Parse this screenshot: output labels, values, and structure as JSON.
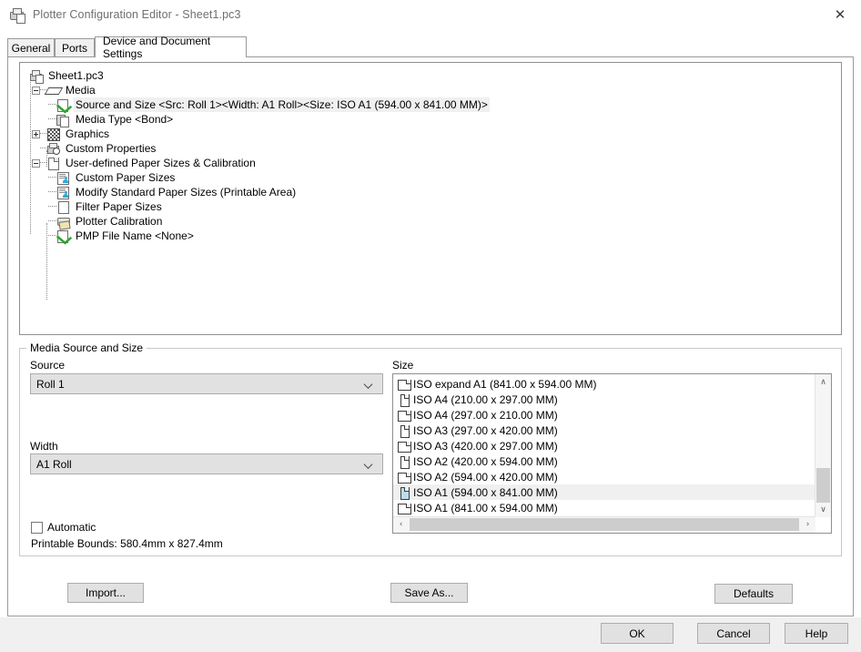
{
  "window": {
    "title": "Plotter Configuration Editor - Sheet1.pc3",
    "icon": "printer-icon",
    "close_label": "✕"
  },
  "tabs": [
    {
      "label": "General",
      "active": false
    },
    {
      "label": "Ports",
      "active": false
    },
    {
      "label": "Device and Document Settings",
      "active": true
    }
  ],
  "tree": {
    "root": {
      "label": "Sheet1.pc3",
      "icon": "printer-config-icon"
    },
    "items": [
      {
        "label": "Media",
        "icon": "media-sheet-icon",
        "expander": "minus",
        "level": 1,
        "selected": false
      },
      {
        "label": "Source and Size <Src:  Roll 1><Width: A1 Roll><Size: ISO A1 (594.00 x 841.00 MM)>",
        "icon": "green-check-page-icon",
        "expander": "none",
        "level": 2,
        "selected": true
      },
      {
        "label": "Media Type <Bond>",
        "icon": "copy-pages-icon",
        "expander": "none",
        "level": 2,
        "selected": false
      },
      {
        "label": "Graphics",
        "icon": "checkerboard-icon",
        "expander": "plus",
        "level": 1,
        "selected": false
      },
      {
        "label": "Custom Properties",
        "icon": "printer-properties-icon",
        "expander": "none",
        "level": 1,
        "selected": false
      },
      {
        "label": "User-defined Paper Sizes & Calibration",
        "icon": "page-corner-icon",
        "expander": "minus",
        "level": 1,
        "selected": false
      },
      {
        "label": "Custom Paper Sizes",
        "icon": "user-page-icon",
        "expander": "none",
        "level": 2,
        "selected": false
      },
      {
        "label": "Modify Standard Paper Sizes (Printable Area)",
        "icon": "user-page-icon",
        "expander": "none",
        "level": 2,
        "selected": false
      },
      {
        "label": "Filter Paper Sizes",
        "icon": "blank-page-icon",
        "expander": "none",
        "level": 2,
        "selected": false
      },
      {
        "label": "Plotter Calibration",
        "icon": "calibration-icon",
        "expander": "none",
        "level": 2,
        "selected": false
      },
      {
        "label": "PMP File Name <None>",
        "icon": "green-check-page-icon",
        "expander": "none",
        "level": 2,
        "selected": false
      }
    ]
  },
  "media_group": {
    "title": "Media Source and Size",
    "source_label": "Source",
    "source_value": "Roll 1",
    "width_label": "Width",
    "width_value": "A1 Roll",
    "automatic_label": "Automatic",
    "automatic_checked": false,
    "bounds_text": "Printable Bounds: 580.4mm x 827.4mm",
    "size_label": "Size",
    "sizes": [
      {
        "label": "ISO expand A1 (841.00 x 594.00 MM)",
        "orientation": "landscape",
        "selected": false
      },
      {
        "label": "ISO A4 (210.00 x 297.00 MM)",
        "orientation": "portrait",
        "selected": false
      },
      {
        "label": "ISO A4 (297.00 x 210.00 MM)",
        "orientation": "landscape",
        "selected": false
      },
      {
        "label": "ISO A3 (297.00 x 420.00 MM)",
        "orientation": "portrait",
        "selected": false
      },
      {
        "label": "ISO A3 (420.00 x 297.00 MM)",
        "orientation": "landscape",
        "selected": false
      },
      {
        "label": "ISO A2 (420.00 x 594.00 MM)",
        "orientation": "portrait",
        "selected": false
      },
      {
        "label": "ISO A2 (594.00 x 420.00 MM)",
        "orientation": "landscape",
        "selected": false
      },
      {
        "label": "ISO A1 (594.00 x 841.00 MM)",
        "orientation": "portrait",
        "selected": true
      },
      {
        "label": "ISO A1 (841.00 x 594.00 MM)",
        "orientation": "landscape",
        "selected": false
      }
    ],
    "scroll": {
      "up_arrow": "∧",
      "down_arrow": "∨",
      "left_arrow": "‹",
      "right_arrow": "›"
    }
  },
  "buttons": {
    "import": "Import...",
    "save_as": "Save As...",
    "defaults": "Defaults",
    "ok": "OK",
    "cancel": "Cancel",
    "help": "Help"
  },
  "colors": {
    "window_bg": "#ffffff",
    "footer_bg": "#f0f0f0",
    "button_face": "#e1e1e1",
    "selection": "#f0f0f0",
    "selected_icon": "#bcdcf4",
    "check_green": "#2aa82a",
    "border": "#8f8f8f"
  }
}
